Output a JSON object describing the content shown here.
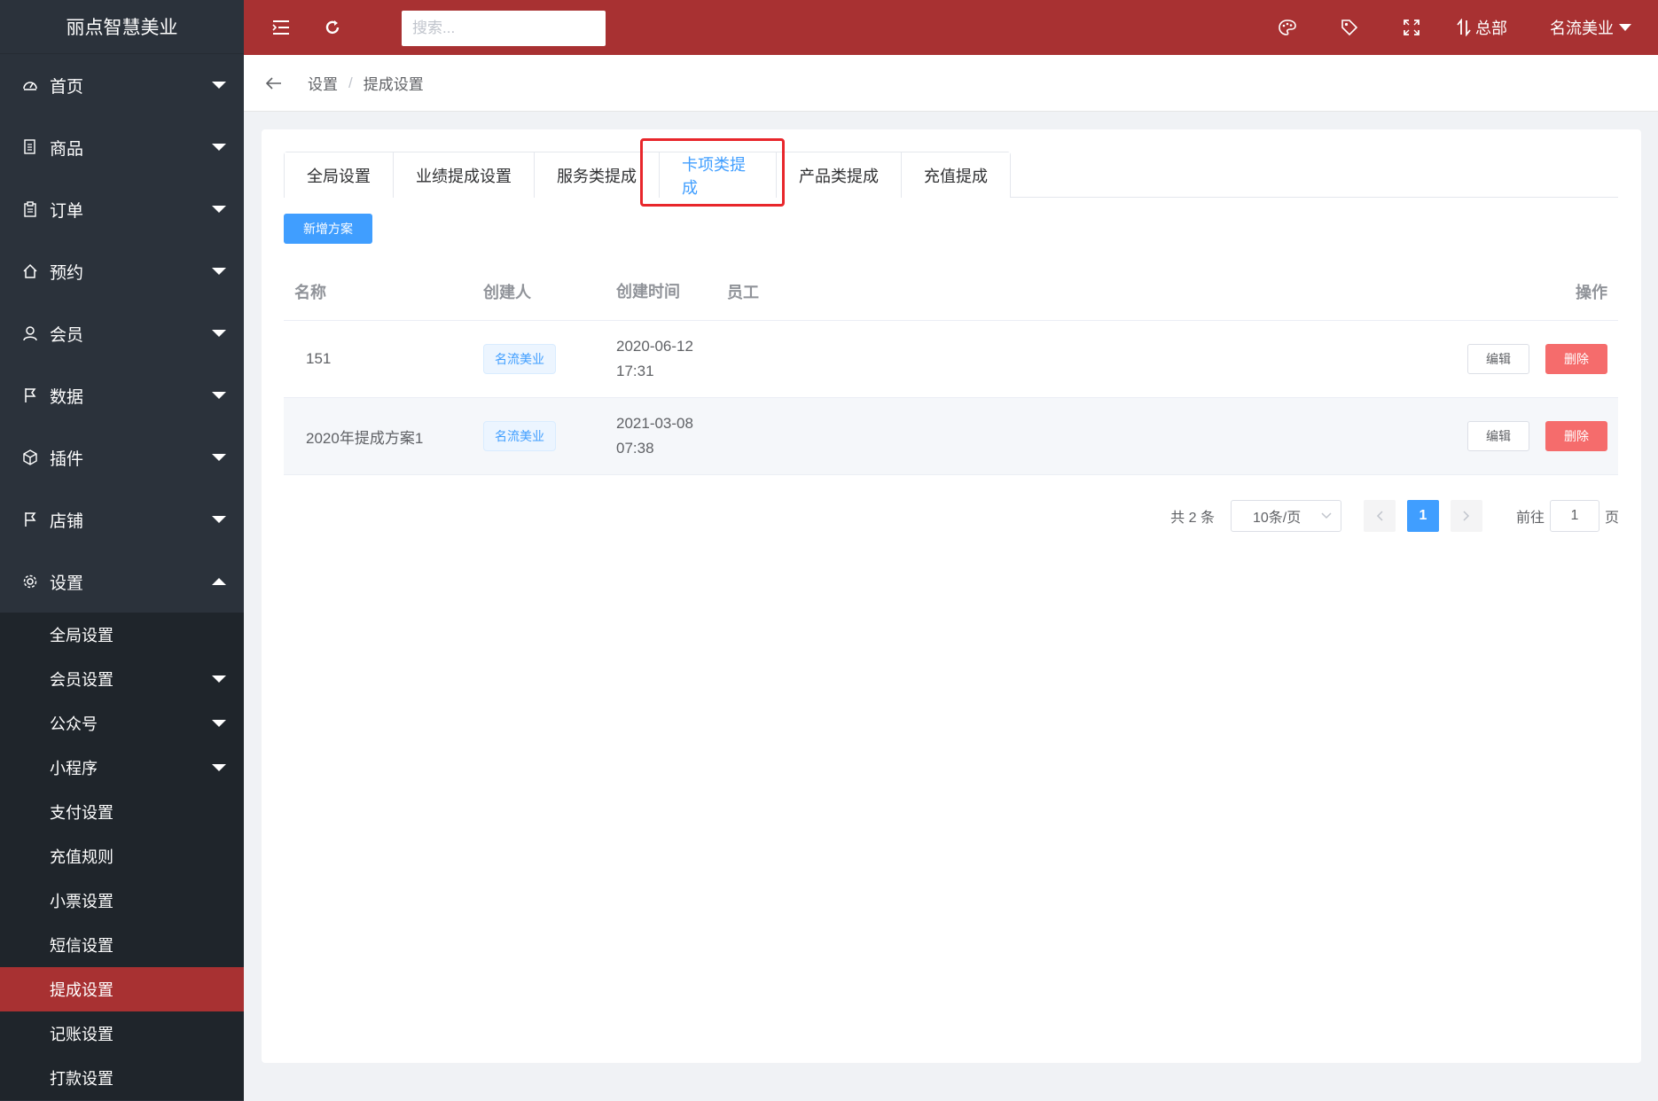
{
  "brand": "丽点智慧美业",
  "search": {
    "placeholder": "搜索..."
  },
  "header_right": {
    "store": "总部",
    "user": "名流美业"
  },
  "sidebar": {
    "items": [
      {
        "label": "首页",
        "icon": "dashboard-icon"
      },
      {
        "label": "商品",
        "icon": "document-icon"
      },
      {
        "label": "订单",
        "icon": "clipboard-icon"
      },
      {
        "label": "预约",
        "icon": "home-icon"
      },
      {
        "label": "会员",
        "icon": "user-icon"
      },
      {
        "label": "数据",
        "icon": "flag-icon"
      },
      {
        "label": "插件",
        "icon": "cube-icon"
      },
      {
        "label": "店铺",
        "icon": "flag-icon"
      },
      {
        "label": "设置",
        "icon": "gear-icon"
      }
    ],
    "sub_items": [
      {
        "label": "全局设置"
      },
      {
        "label": "会员设置"
      },
      {
        "label": "公众号"
      },
      {
        "label": "小程序"
      },
      {
        "label": "支付设置"
      },
      {
        "label": "充值规则"
      },
      {
        "label": "小票设置"
      },
      {
        "label": "短信设置"
      },
      {
        "label": "提成设置"
      },
      {
        "label": "记账设置"
      },
      {
        "label": "打款设置"
      }
    ]
  },
  "breadcrumb": {
    "parent": "设置",
    "sep": "/",
    "current": "提成设置"
  },
  "tabs": [
    {
      "label": "全局设置"
    },
    {
      "label": "业绩提成设置"
    },
    {
      "label": "服务类提成"
    },
    {
      "label": "卡项类提成"
    },
    {
      "label": "产品类提成"
    },
    {
      "label": "充值提成"
    }
  ],
  "add_button": "新增方案",
  "table": {
    "headers": {
      "name": "名称",
      "creator": "创建人",
      "time": "创建时间",
      "staff": "员工",
      "ops": "操作"
    },
    "rows": [
      {
        "name": "151",
        "creator": "名流美业",
        "date": "2020-06-12",
        "clock": "17:31",
        "edit": "编辑",
        "delete": "删除"
      },
      {
        "name": "2020年提成方案1",
        "creator": "名流美业",
        "date": "2021-03-08",
        "clock": "07:38",
        "edit": "编辑",
        "delete": "删除"
      }
    ]
  },
  "pagination": {
    "total": "共 2 条",
    "page_size": "10条/页",
    "current": "1",
    "goto_label": "前往",
    "goto_value": "1",
    "goto_unit": "页"
  }
}
